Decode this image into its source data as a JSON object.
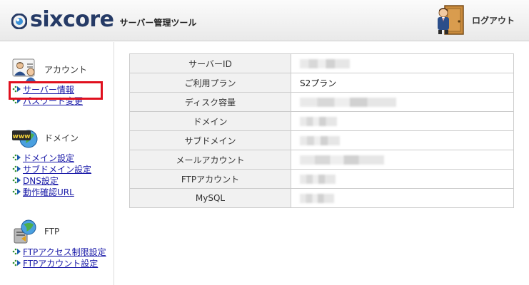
{
  "header": {
    "logo_text": "sixcore",
    "subtitle": "サーバー管理ツール",
    "logout_label": "ログアウト"
  },
  "sidebar": {
    "sections": [
      {
        "title": "アカウント",
        "icon": "user-card-icon",
        "items": [
          {
            "label": "サーバー情報",
            "selected": true
          },
          {
            "label": "パスワード変更",
            "selected": false
          }
        ]
      },
      {
        "title": "ドメイン",
        "icon": "www-globe-icon",
        "items": [
          {
            "label": "ドメイン設定"
          },
          {
            "label": "サブドメイン設定"
          },
          {
            "label": "DNS設定"
          },
          {
            "label": "動作確認URL"
          }
        ]
      },
      {
        "title": "FTP",
        "icon": "ftp-globe-icon",
        "items": [
          {
            "label": "FTPアクセス制限設定"
          },
          {
            "label": "FTPアカウント設定"
          }
        ]
      }
    ]
  },
  "main": {
    "rows": [
      {
        "label": "サーバーID",
        "value": ""
      },
      {
        "label": "ご利用プラン",
        "value": "S2プラン"
      },
      {
        "label": "ディスク容量",
        "value": ""
      },
      {
        "label": "ドメイン",
        "value": ""
      },
      {
        "label": "サブドメイン",
        "value": ""
      },
      {
        "label": "メールアカウント",
        "value": ""
      },
      {
        "label": "FTPアカウント",
        "value": ""
      },
      {
        "label": "MySQL",
        "value": ""
      }
    ]
  },
  "colors": {
    "logo": "#253a66",
    "link": "#1a1aa8",
    "highlight": "#e0101e",
    "label_bg": "#f1f1f1"
  }
}
